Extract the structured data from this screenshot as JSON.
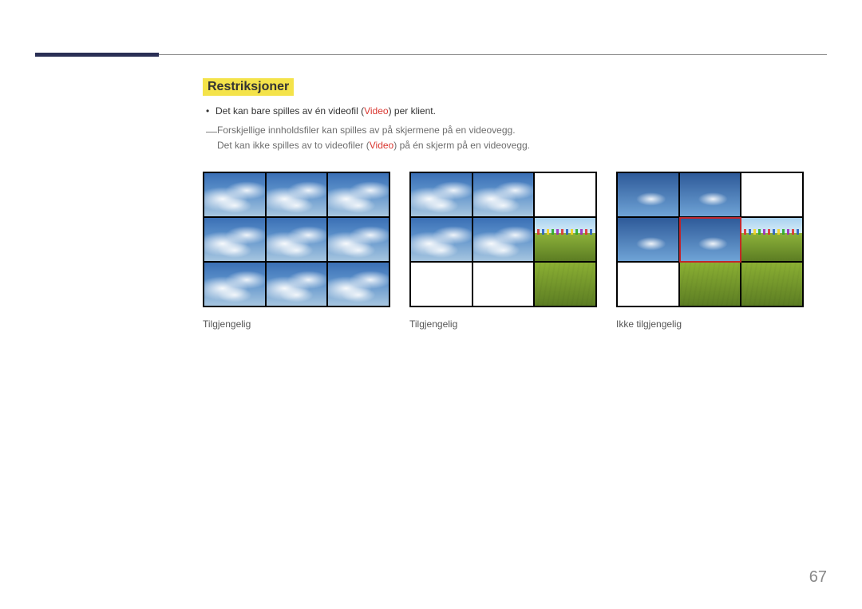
{
  "heading": "Restriksjoner",
  "bullet": {
    "pre": "Det kan bare spilles av én videofil (",
    "kw": "Video",
    "post": ") per klient."
  },
  "note": {
    "marker": "―",
    "line1": "Forskjellige innholdsfiler kan spilles av på skjermene på en videovegg.",
    "line2_pre": "Det kan ikke spilles av to videofiler (",
    "line2_kw": "Video",
    "line2_post": ") på én skjerm på en videovegg."
  },
  "figures": [
    {
      "caption": "Tilgjengelig"
    },
    {
      "caption": "Tilgjengelig"
    },
    {
      "caption": "Ikke tilgjengelig"
    }
  ],
  "pageNumber": "67"
}
